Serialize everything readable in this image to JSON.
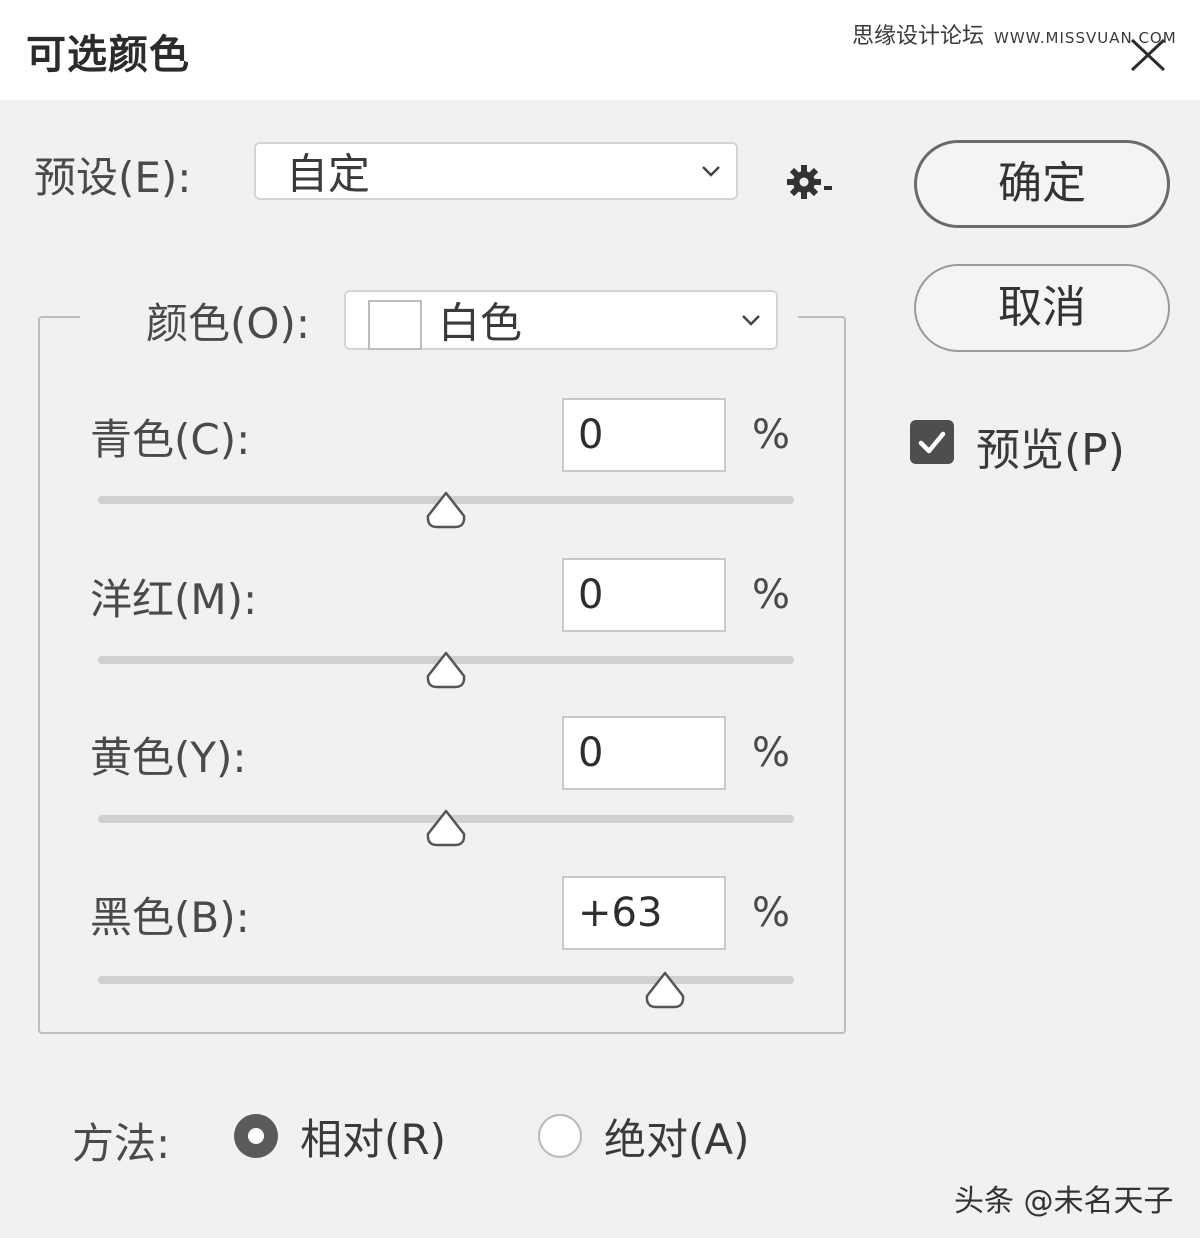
{
  "dialog": {
    "title": "可选颜色",
    "watermark_site": "思缘设计论坛",
    "watermark_url": "WWW.MISSVUAN.COM",
    "close_icon": "close-icon"
  },
  "preset": {
    "label": "预设(E):",
    "value": "自定",
    "settings_icon": "gear-icon"
  },
  "buttons": {
    "ok": "确定",
    "cancel": "取消"
  },
  "preview": {
    "label": "预览(P)",
    "checked": true
  },
  "colors": {
    "label": "颜色(O):",
    "value": "白色",
    "swatch_color": "#ffffff"
  },
  "sliders": [
    {
      "label": "青色(C):",
      "value": "0",
      "unit": "%",
      "level": 0.5
    },
    {
      "label": "洋红(M):",
      "value": "0",
      "unit": "%",
      "level": 0.5
    },
    {
      "label": "黄色(Y):",
      "value": "0",
      "unit": "%",
      "level": 0.5
    },
    {
      "label": "黑色(B):",
      "value": "+63",
      "unit": "%",
      "level": 0.815
    }
  ],
  "method": {
    "label": "方法:",
    "options": [
      {
        "label": "相对(R)",
        "selected": true
      },
      {
        "label": "绝对(A)",
        "selected": false
      }
    ]
  },
  "footer": {
    "watermark": "头条 @未名天子"
  }
}
